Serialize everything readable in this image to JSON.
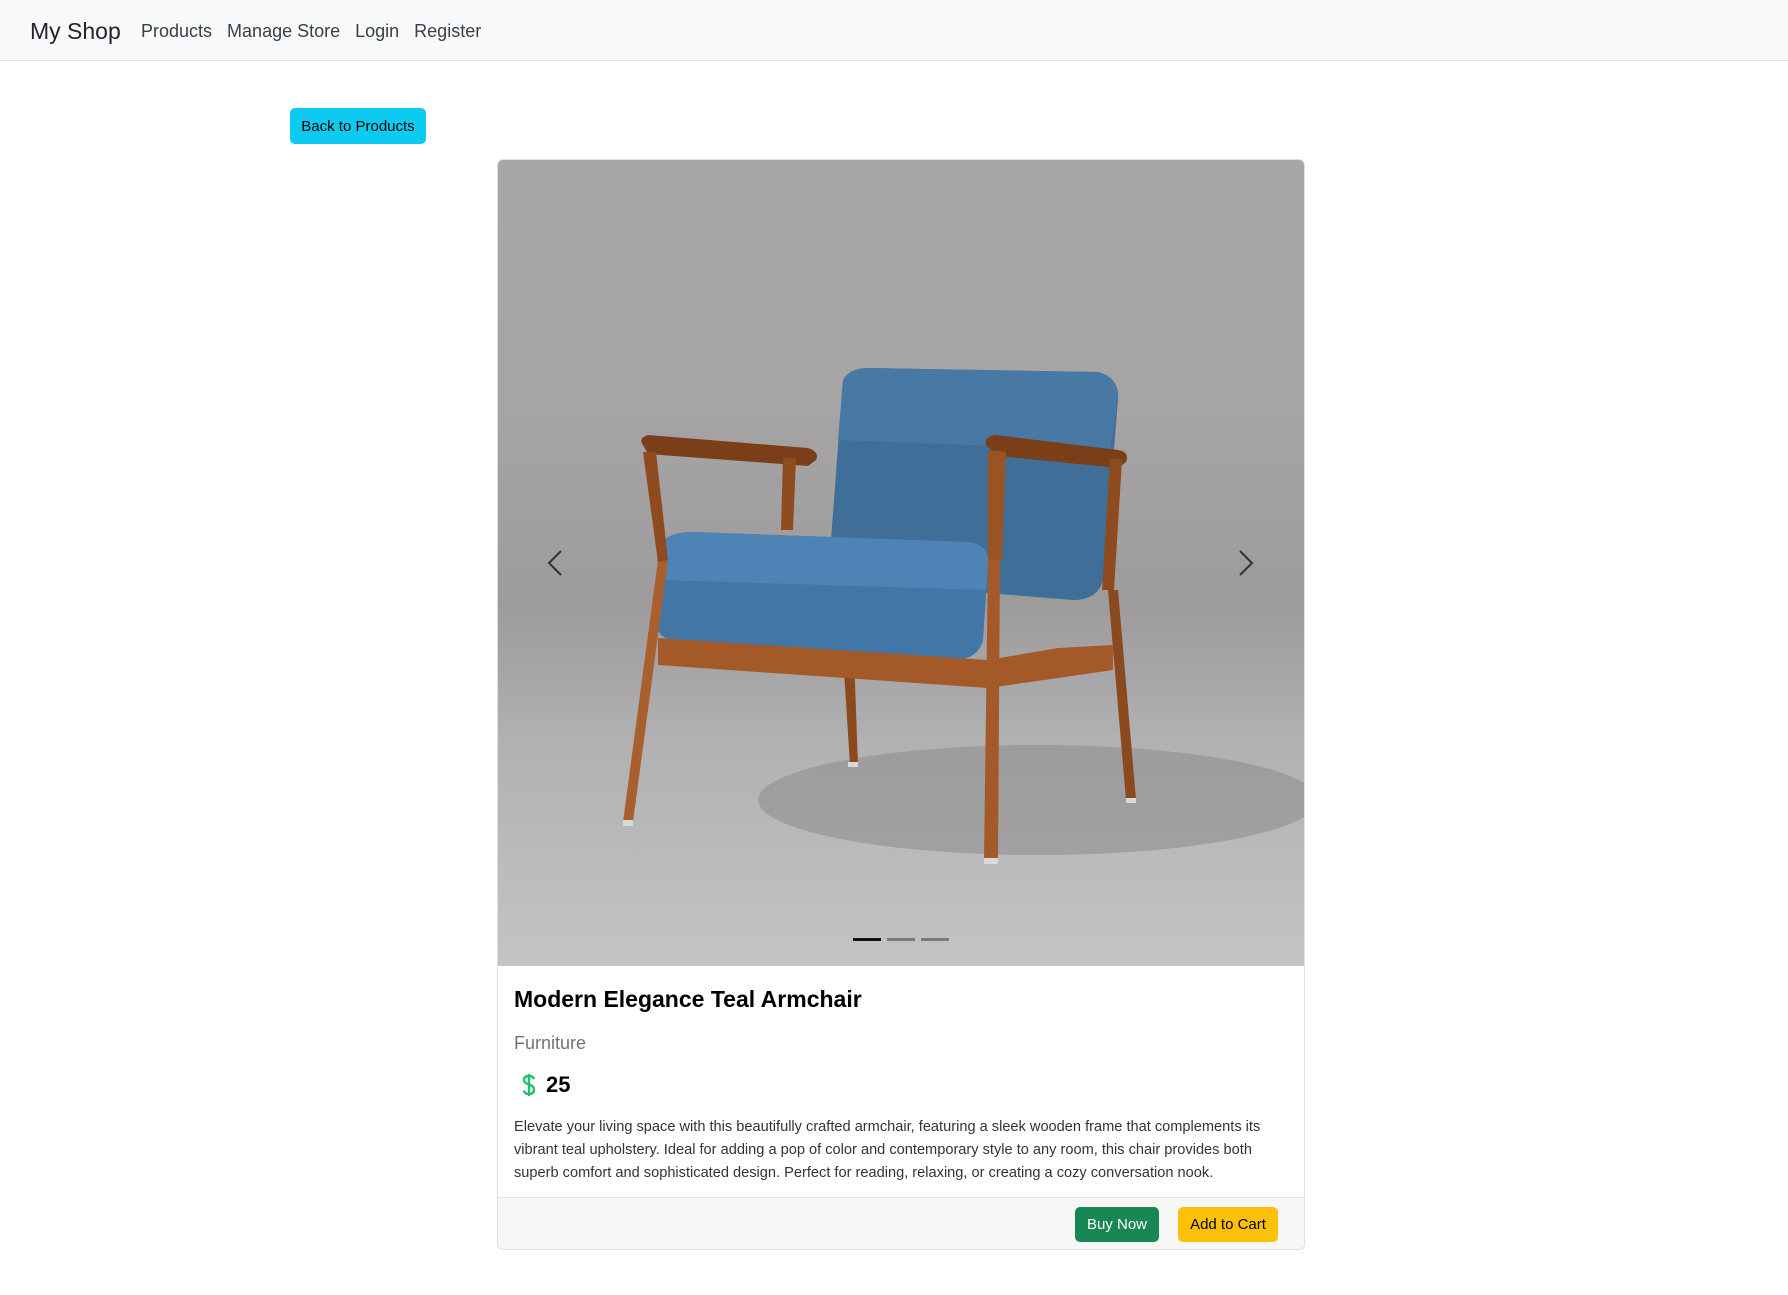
{
  "navbar": {
    "brand": "My Shop",
    "links": [
      "Products",
      "Manage Store",
      "Login",
      "Register"
    ]
  },
  "back_button": "Back to Products",
  "carousel": {
    "slide_count": 3,
    "active_index": 0
  },
  "product": {
    "title": "Modern Elegance Teal Armchair",
    "category": "Furniture",
    "price": "25",
    "description": "Elevate your living space with this beautifully crafted armchair, featuring a sleek wooden frame that complements its vibrant teal upholstery. Ideal for adding a pop of color and contemporary style to any room, this chair provides both superb comfort and sophisticated design. Perfect for reading, relaxing, or creating a cozy conversation nook."
  },
  "actions": {
    "buy_now": "Buy Now",
    "add_to_cart": "Add to Cart"
  },
  "colors": {
    "info": "#0dcaf0",
    "success": "#198754",
    "warning": "#ffc107",
    "price_icon": "#20c073"
  }
}
